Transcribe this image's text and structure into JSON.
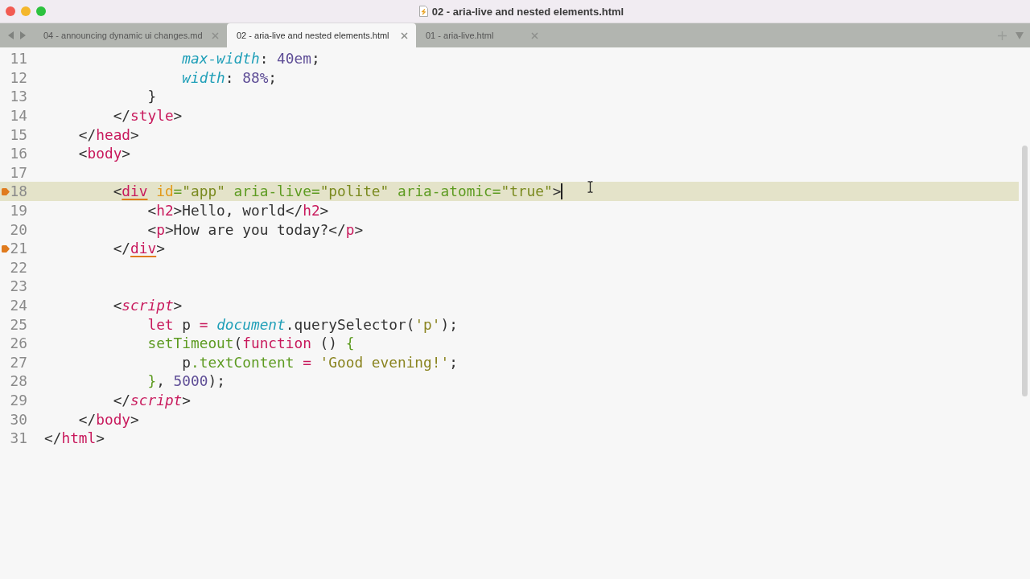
{
  "window": {
    "title": "02 - aria-live and nested elements.html"
  },
  "tabs": [
    {
      "label": "04 - announcing dynamic ui changes.md",
      "selected": false
    },
    {
      "label": "02 - aria-live and nested elements.html",
      "selected": true
    },
    {
      "label": "01 - aria-live.html",
      "selected": false
    }
  ],
  "editor": {
    "lines": [
      {
        "number": "11",
        "bookmarked": false,
        "current": false,
        "tokens": [
          {
            "kind": "prop",
            "text": "                max-width"
          },
          {
            "kind": "plain",
            "text": ": "
          },
          {
            "kind": "number",
            "text": "40em"
          },
          {
            "kind": "plain",
            "text": ";"
          }
        ]
      },
      {
        "number": "12",
        "bookmarked": false,
        "current": false,
        "tokens": [
          {
            "kind": "prop",
            "text": "                width"
          },
          {
            "kind": "plain",
            "text": ": "
          },
          {
            "kind": "number",
            "text": "88%"
          },
          {
            "kind": "plain",
            "text": ";"
          }
        ]
      },
      {
        "number": "13",
        "bookmarked": false,
        "current": false,
        "tokens": [
          {
            "kind": "plain",
            "text": "            }"
          }
        ]
      },
      {
        "number": "14",
        "bookmarked": false,
        "current": false,
        "tokens": [
          {
            "kind": "plain",
            "text": "        </"
          },
          {
            "kind": "tag",
            "text": "style"
          },
          {
            "kind": "plain",
            "text": ">"
          }
        ]
      },
      {
        "number": "15",
        "bookmarked": false,
        "current": false,
        "tokens": [
          {
            "kind": "plain",
            "text": "    </"
          },
          {
            "kind": "tag",
            "text": "head"
          },
          {
            "kind": "plain",
            "text": ">"
          }
        ]
      },
      {
        "number": "16",
        "bookmarked": false,
        "current": false,
        "tokens": [
          {
            "kind": "plain",
            "text": "    <"
          },
          {
            "kind": "tag",
            "text": "body"
          },
          {
            "kind": "plain",
            "text": ">"
          }
        ]
      },
      {
        "number": "17",
        "bookmarked": false,
        "current": false
      },
      {
        "number": "18",
        "bookmarked": true,
        "current": true,
        "tokens": [
          {
            "kind": "plain",
            "text": "        <"
          },
          {
            "kind": "tag-matched",
            "text": "div"
          },
          {
            "kind": "attr",
            "text": " id"
          },
          {
            "kind": "attr-alt",
            "text": "="
          },
          {
            "kind": "string",
            "text": "\"app\""
          },
          {
            "kind": "attr-alt",
            "text": " aria-live="
          },
          {
            "kind": "string",
            "text": "\"polite\""
          },
          {
            "kind": "attr-alt",
            "text": " aria-atomic="
          },
          {
            "kind": "string",
            "text": "\"true\""
          },
          {
            "kind": "plain",
            "text": ">"
          }
        ]
      },
      {
        "number": "19",
        "bookmarked": false,
        "current": false,
        "tokens": [
          {
            "kind": "plain",
            "text": "            <"
          },
          {
            "kind": "tag",
            "text": "h2"
          },
          {
            "kind": "plain",
            "text": ">Hello, world</"
          },
          {
            "kind": "tag",
            "text": "h2"
          },
          {
            "kind": "plain",
            "text": ">"
          }
        ]
      },
      {
        "number": "20",
        "bookmarked": false,
        "current": false,
        "tokens": [
          {
            "kind": "plain",
            "text": "            <"
          },
          {
            "kind": "tag",
            "text": "p"
          },
          {
            "kind": "plain",
            "text": ">How are you today?</"
          },
          {
            "kind": "tag",
            "text": "p"
          },
          {
            "kind": "plain",
            "text": ">"
          }
        ]
      },
      {
        "number": "21",
        "bookmarked": true,
        "current": false,
        "tokens": [
          {
            "kind": "plain",
            "text": "        </"
          },
          {
            "kind": "tag-matched",
            "text": "div"
          },
          {
            "kind": "plain",
            "text": ">"
          }
        ]
      },
      {
        "number": "22",
        "bookmarked": false,
        "current": false
      },
      {
        "number": "23",
        "bookmarked": false,
        "current": false
      },
      {
        "number": "24",
        "bookmarked": false,
        "current": false,
        "tokens": [
          {
            "kind": "plain",
            "text": "        <"
          },
          {
            "kind": "tag-italic",
            "text": "script"
          },
          {
            "kind": "plain",
            "text": ">"
          }
        ]
      },
      {
        "number": "25",
        "bookmarked": false,
        "current": false,
        "tokens": [
          {
            "kind": "keyword",
            "text": "            let"
          },
          {
            "kind": "plain",
            "text": " p "
          },
          {
            "kind": "keyword",
            "text": "="
          },
          {
            "kind": "builtin",
            "text": " document"
          },
          {
            "kind": "plain",
            "text": ".querySelector("
          },
          {
            "kind": "js-string",
            "text": "'p'"
          },
          {
            "kind": "plain",
            "text": ");"
          }
        ]
      },
      {
        "number": "26",
        "bookmarked": false,
        "current": false,
        "tokens": [
          {
            "kind": "func",
            "text": "            setTimeout"
          },
          {
            "kind": "plain",
            "text": "("
          },
          {
            "kind": "keyword",
            "text": "function"
          },
          {
            "kind": "plain",
            "text": " () "
          },
          {
            "kind": "func",
            "text": "{"
          }
        ]
      },
      {
        "number": "27",
        "bookmarked": false,
        "current": false,
        "tokens": [
          {
            "kind": "plain",
            "text": "                p"
          },
          {
            "kind": "func",
            "text": ".textContent"
          },
          {
            "kind": "keyword",
            "text": " ="
          },
          {
            "kind": "js-string",
            "text": " 'Good evening!'"
          },
          {
            "kind": "plain",
            "text": ";"
          }
        ]
      },
      {
        "number": "28",
        "bookmarked": false,
        "current": false,
        "tokens": [
          {
            "kind": "func",
            "text": "            }"
          },
          {
            "kind": "plain",
            "text": ", "
          },
          {
            "kind": "number",
            "text": "5000"
          },
          {
            "kind": "plain",
            "text": ");"
          }
        ]
      },
      {
        "number": "29",
        "bookmarked": false,
        "current": false,
        "tokens": [
          {
            "kind": "plain",
            "text": "        </"
          },
          {
            "kind": "tag-italic",
            "text": "script"
          },
          {
            "kind": "plain",
            "text": ">"
          }
        ]
      },
      {
        "number": "30",
        "bookmarked": false,
        "current": false,
        "tokens": [
          {
            "kind": "plain",
            "text": "    </"
          },
          {
            "kind": "tag",
            "text": "body"
          },
          {
            "kind": "plain",
            "text": ">"
          }
        ]
      },
      {
        "number": "31",
        "bookmarked": false,
        "current": false,
        "tokens": [
          {
            "kind": "plain",
            "text": "</"
          },
          {
            "kind": "tag",
            "text": "html"
          },
          {
            "kind": "plain",
            "text": ">"
          }
        ]
      }
    ]
  }
}
